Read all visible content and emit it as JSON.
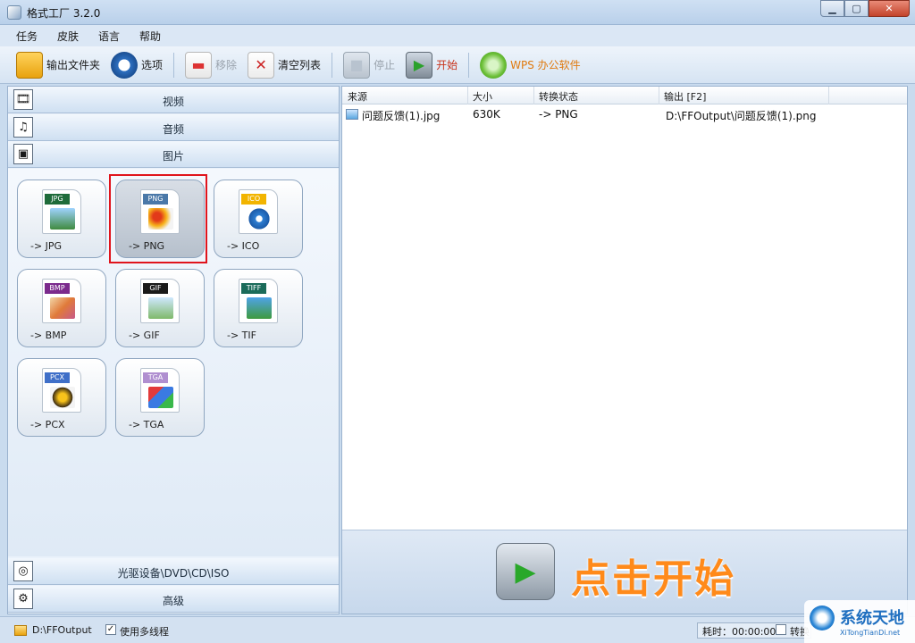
{
  "window": {
    "title": "格式工厂 3.2.0",
    "min": "▁",
    "max": "▢",
    "close": "✕"
  },
  "menu": [
    "任务",
    "皮肤",
    "语言",
    "帮助"
  ],
  "toolbar": {
    "output_folder": "输出文件夹",
    "options": "选项",
    "remove": "移除",
    "clear_list": "清空列表",
    "stop": "停止",
    "start": "开始",
    "wps": "WPS 办公软件"
  },
  "categories": {
    "video": "视频",
    "audio": "音频",
    "image": "图片",
    "optical": "光驱设备\\DVD\\CD\\ISO",
    "advanced": "高级"
  },
  "formats": [
    {
      "tag": "JPG",
      "label": "-> JPG",
      "color": "#1e6b3a"
    },
    {
      "tag": "PNG",
      "label": "-> PNG",
      "color": "#4a78a8"
    },
    {
      "tag": "ICO",
      "label": "-> ICO",
      "color": "#f2b400"
    },
    {
      "tag": "BMP",
      "label": "-> BMP",
      "color": "#7b2a8c"
    },
    {
      "tag": "GIF",
      "label": "-> GIF",
      "color": "#1a1a1a"
    },
    {
      "tag": "TIFF",
      "label": "-> TIF",
      "color": "#1b6b5a"
    },
    {
      "tag": "PCX",
      "label": "-> PCX",
      "color": "#3f6fc8"
    },
    {
      "tag": "TGA",
      "label": "-> TGA",
      "color": "#b08fd0"
    }
  ],
  "table": {
    "headers": [
      "来源",
      "大小",
      "转换状态",
      "输出 [F2]"
    ],
    "rows": [
      {
        "source": "问题反馈(1).jpg",
        "size": "630K",
        "status": "-> PNG",
        "output": "D:\\FFOutput\\问题反馈(1).png"
      }
    ]
  },
  "banner": {
    "text": "点击开始"
  },
  "status": {
    "path": "D:\\FFOutput",
    "multithread_checked": "✓",
    "multithread_label": "使用多线程",
    "time": "耗时：00:00:00",
    "convert_label": "转换"
  },
  "watermark": {
    "title": "系统天地",
    "subtitle": "XiTongTianDi.net"
  }
}
